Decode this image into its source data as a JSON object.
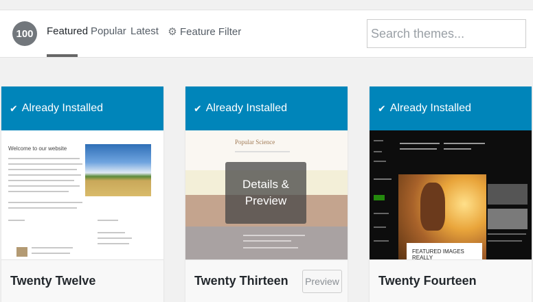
{
  "filter_bar": {
    "count": "100",
    "tabs": [
      "Featured",
      "Popular",
      "Latest"
    ],
    "feature_filter": "Feature Filter",
    "search_placeholder": "Search themes..."
  },
  "colors": {
    "accent": "#0085ba",
    "count_badge": "#72777c"
  },
  "themes": [
    {
      "name": "Twenty Twelve",
      "status": "Already Installed",
      "screenshot_text": "Welcome to our website"
    },
    {
      "name": "Twenty Thirteen",
      "status": "Already Installed",
      "screenshot_text": "Popular Science",
      "overlay": "Details & Preview",
      "preview_button": "Preview"
    },
    {
      "name": "Twenty Fourteen",
      "status": "Already Installed",
      "screenshot_text": "FEATURED IMAGES REALLY"
    }
  ]
}
